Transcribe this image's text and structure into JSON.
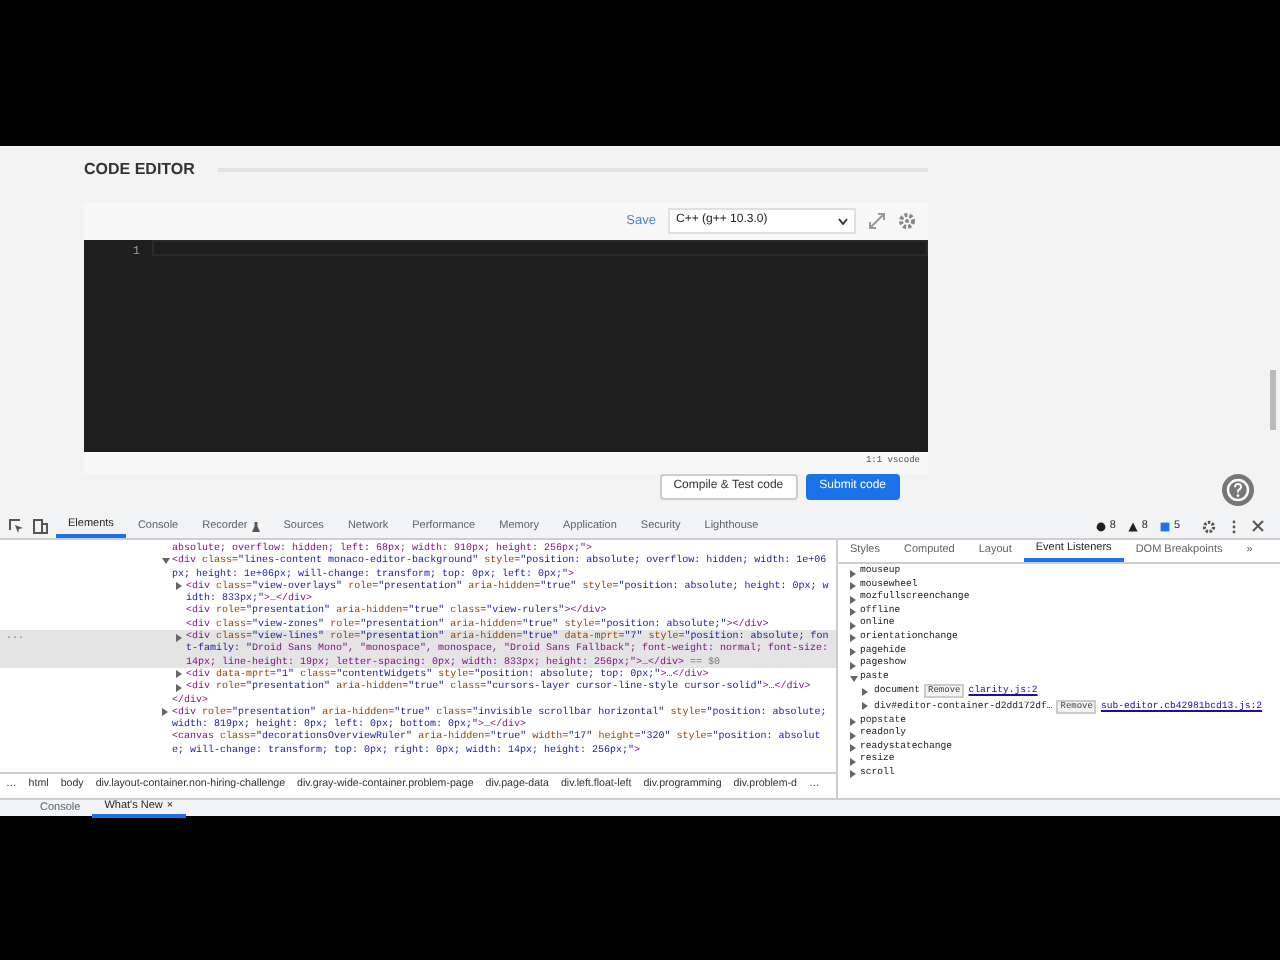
{
  "page": {
    "heading": "CODE EDITOR",
    "save": "Save",
    "language": "C++ (g++ 10.3.0)",
    "line_numbers": [
      "1"
    ],
    "status": "1:1 vscode",
    "buttons": [
      {
        "label": "Compile & Test code",
        "kind": "outline"
      },
      {
        "label": "Submit code",
        "kind": "primary"
      }
    ]
  },
  "devtools": {
    "tabs": [
      {
        "label": "Elements",
        "selected": true
      },
      {
        "label": "Console",
        "selected": false
      },
      {
        "label": "Recorder",
        "selected": false
      },
      {
        "label": "Sources",
        "selected": false
      },
      {
        "label": "Network",
        "selected": false
      },
      {
        "label": "Performance",
        "selected": false
      },
      {
        "label": "Memory",
        "selected": false
      },
      {
        "label": "Application",
        "selected": false
      },
      {
        "label": "Security",
        "selected": false
      },
      {
        "label": "Lighthouse",
        "selected": false
      }
    ],
    "issues": [
      {
        "kind": "error",
        "count": "8"
      },
      {
        "kind": "warning",
        "count": "8"
      },
      {
        "kind": "info",
        "count": "5"
      }
    ],
    "dom_tree": [
      {
        "text": "absolute; overflow: hidden; left: 68px; width: 910px; height: 256px;\">",
        "selected": false
      },
      {
        "text": "<div class=\"lines-content monaco-editor-background\" style=\"position: absolute; overflow: hidden; width: 1e+06px; height: 1e+06px; will-change: transform; top: 0px; left: 0px;\">",
        "selected": false,
        "expanded": true,
        "closing": "</div>",
        "children": [
          {
            "text": "<div class=\"view-overlays\" role=\"presentation\" aria-hidden=\"true\" style=\"position: absolute; height: 0px; width: 833px;\">…</div>",
            "selected": false,
            "expanded": false
          },
          {
            "text": "<div role=\"presentation\" aria-hidden=\"true\" class=\"view-rulers\"></div>",
            "selected": false
          },
          {
            "text": "<div class=\"view-zones\" role=\"presentation\" aria-hidden=\"true\" style=\"position: absolute;\"></div>",
            "selected": false
          },
          {
            "text": "<div class=\"view-lines\" role=\"presentation\" aria-hidden=\"true\" data-mprt=\"7\" style=\"position: absolute; font-family: \"Droid Sans Mono\", \"monospace\", monospace, \"Droid Sans Fallback\"; font-weight: normal; font-size: 14px; line-height: 19px; letter-spacing: 0px; width: 833px; height: 256px;\">…</div>",
            "selected": true,
            "expanded": false,
            "marker": "== $0",
            "gutter": "..."
          },
          {
            "text": "<div data-mprt=\"1\" class=\"contentWidgets\" style=\"position: absolute; top: 0px;\">…</div>",
            "selected": false,
            "expanded": false
          },
          {
            "text": "<div role=\"presentation\" aria-hidden=\"true\" class=\"cursors-layer cursor-line-style cursor-solid\">…</div>",
            "selected": false,
            "expanded": false
          }
        ]
      },
      {
        "text": "<div role=\"presentation\" aria-hidden=\"true\" class=\"invisible scrollbar horizontal\" style=\"position: absolute; width: 819px; height: 0px; left: 0px; bottom: 0px;\">…</div>",
        "selected": false,
        "expanded": false
      },
      {
        "text": "<canvas class=\"decorationsOverviewRuler\" aria-hidden=\"true\" width=\"17\" height=\"320\" style=\"position: absolute; will-change: transform; top: 0px; right: 0px; width: 14px; height: 256px;\">",
        "selected": false
      }
    ],
    "breadcrumbs": {
      "more_left": "…",
      "items": [
        "html",
        "body",
        "div.layout-container.non-hiring-challenge",
        "div.gray-wide-container.problem-page",
        "div.page-data",
        "div.left.float-left",
        "div.programming",
        "div.problem-d"
      ],
      "more_right": "…"
    },
    "side_tabs": [
      {
        "label": "Styles",
        "selected": false
      },
      {
        "label": "Computed",
        "selected": false
      },
      {
        "label": "Layout",
        "selected": false
      },
      {
        "label": "Event Listeners",
        "selected": true
      },
      {
        "label": "DOM Breakpoints",
        "selected": false
      }
    ],
    "side_more": "»",
    "listeners": [
      {
        "name": "mouseup",
        "expanded": false
      },
      {
        "name": "mousewheel",
        "expanded": false
      },
      {
        "name": "mozfullscreenchange",
        "expanded": false
      },
      {
        "name": "offline",
        "expanded": false
      },
      {
        "name": "online",
        "expanded": false
      },
      {
        "name": "orientationchange",
        "expanded": false
      },
      {
        "name": "pagehide",
        "expanded": false
      },
      {
        "name": "pageshow",
        "expanded": false
      },
      {
        "name": "paste",
        "expanded": true,
        "children": [
          {
            "target": "document",
            "remove": "Remove",
            "source": "clarity.js:2",
            "expanded": false
          },
          {
            "target": "div#editor-container-d2dd172df…",
            "remove": "Remove",
            "source": "sub-editor.cb42981bcd13.js:2",
            "expanded": false
          }
        ]
      },
      {
        "name": "popstate",
        "expanded": false
      },
      {
        "name": "readonly",
        "expanded": false
      },
      {
        "name": "readystatechange",
        "expanded": false
      },
      {
        "name": "resize",
        "expanded": false
      },
      {
        "name": "scroll",
        "expanded": false
      }
    ],
    "drawer_tabs": [
      {
        "label": "Console",
        "selected": false
      },
      {
        "label": "What's New",
        "selected": true
      }
    ],
    "drawer_close": "×"
  }
}
